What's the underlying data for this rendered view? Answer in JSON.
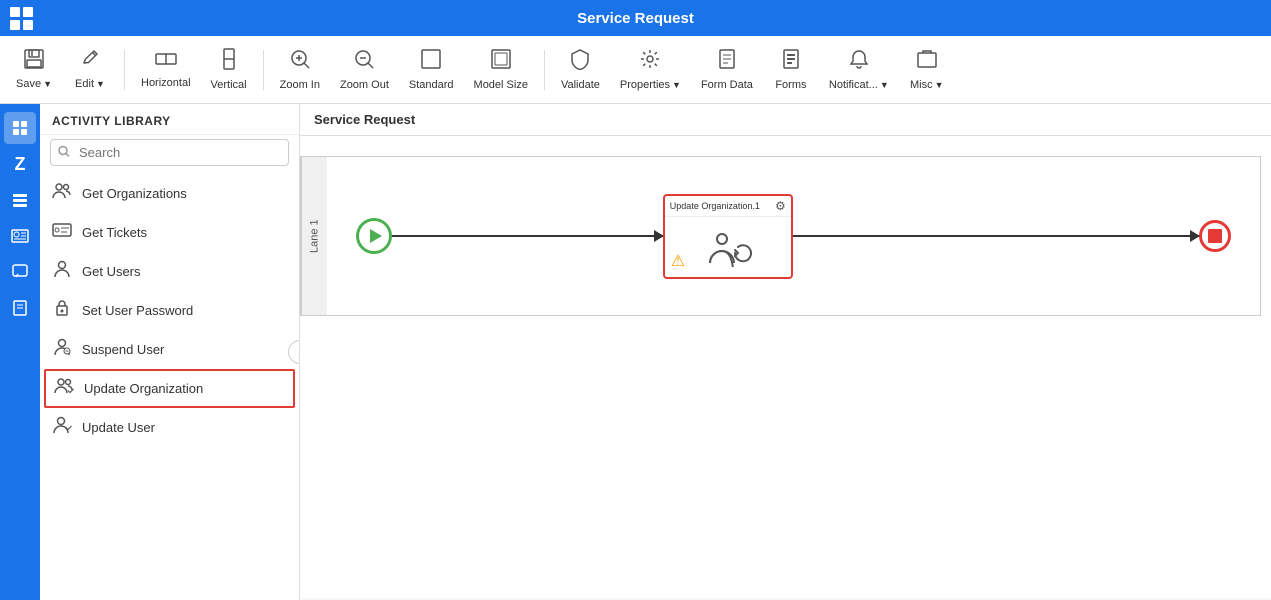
{
  "header": {
    "title": "Service Request",
    "grid_icon_label": "App grid"
  },
  "toolbar": {
    "buttons": [
      {
        "id": "save",
        "icon": "💾",
        "label": "Save",
        "has_arrow": true
      },
      {
        "id": "edit",
        "icon": "✏️",
        "label": "Edit",
        "has_arrow": true
      },
      {
        "id": "horizontal",
        "icon": "⬌",
        "label": "Horizontal",
        "has_arrow": false
      },
      {
        "id": "vertical",
        "icon": "⬍",
        "label": "Vertical",
        "has_arrow": false
      },
      {
        "id": "zoom-in",
        "icon": "🔍+",
        "label": "Zoom In",
        "has_arrow": false
      },
      {
        "id": "zoom-out",
        "icon": "🔍-",
        "label": "Zoom Out",
        "has_arrow": false
      },
      {
        "id": "standard",
        "icon": "⬚",
        "label": "Standard",
        "has_arrow": false
      },
      {
        "id": "model-size",
        "icon": "⊡",
        "label": "Model Size",
        "has_arrow": false
      },
      {
        "id": "validate",
        "icon": "🛡",
        "label": "Validate",
        "has_arrow": false
      },
      {
        "id": "properties",
        "icon": "⚙",
        "label": "Properties",
        "has_arrow": true
      },
      {
        "id": "form-data",
        "icon": "📋",
        "label": "Form Data",
        "has_arrow": false
      },
      {
        "id": "forms",
        "icon": "📄",
        "label": "Forms",
        "has_arrow": false
      },
      {
        "id": "notifications",
        "icon": "🔔",
        "label": "Notificat...",
        "has_arrow": true
      },
      {
        "id": "misc",
        "icon": "📁",
        "label": "Misc",
        "has_arrow": true
      }
    ]
  },
  "nav_strip": {
    "icons": [
      {
        "id": "home",
        "symbol": "⊞",
        "active": true
      },
      {
        "id": "zendesk",
        "symbol": "Z",
        "active": false
      },
      {
        "id": "list",
        "symbol": "≡",
        "active": false
      },
      {
        "id": "id-card",
        "symbol": "🪪",
        "active": false
      },
      {
        "id": "chat",
        "symbol": "💬",
        "active": false
      },
      {
        "id": "book",
        "symbol": "📚",
        "active": false
      }
    ]
  },
  "activity_library": {
    "header": "Activity Library",
    "search_placeholder": "Search",
    "items": [
      {
        "id": "get-organizations",
        "icon": "👥",
        "label": "Get Organizations"
      },
      {
        "id": "get-tickets",
        "icon": "🎫",
        "label": "Get Tickets"
      },
      {
        "id": "get-users",
        "icon": "👤",
        "label": "Get Users"
      },
      {
        "id": "set-user-password",
        "icon": "🔒",
        "label": "Set User Password"
      },
      {
        "id": "suspend-user",
        "icon": "👤",
        "label": "Suspend User"
      },
      {
        "id": "update-organization",
        "icon": "👥",
        "label": "Update Organization",
        "selected": true
      },
      {
        "id": "update-user",
        "icon": "👤",
        "label": "Update User"
      }
    ]
  },
  "canvas": {
    "title": "Service Request",
    "lane_label": "Lane 1",
    "activity_node": {
      "title": "Update Organization.1",
      "has_warning": true,
      "warning_symbol": "⚠"
    }
  }
}
